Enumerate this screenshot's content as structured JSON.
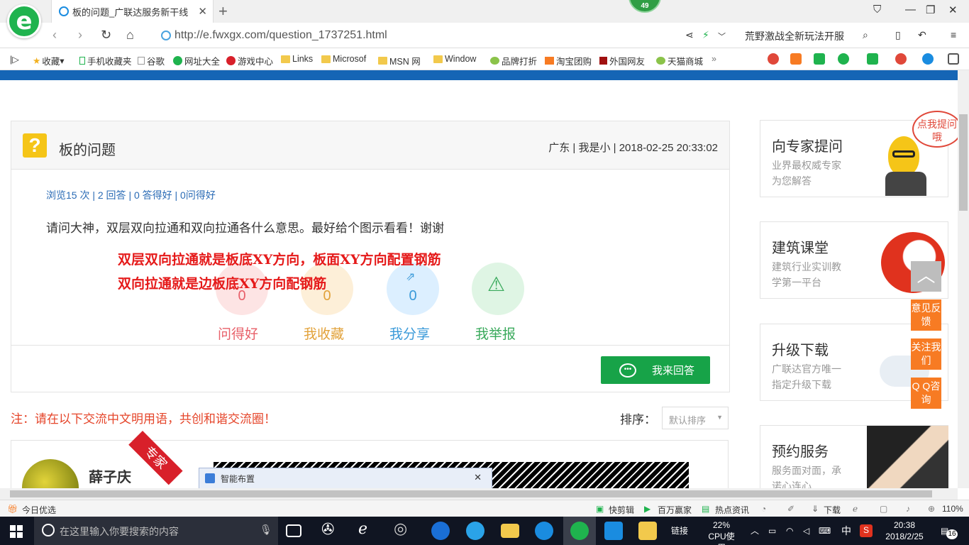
{
  "browser": {
    "tab_title": "板的问题_广联达服务新干线",
    "notif_count": "49",
    "url": "http://e.fwxgx.com/question_1737251.html",
    "news_ticker": "荒野激战全新玩法开服"
  },
  "bookmarks": [
    {
      "label": "收藏"
    },
    {
      "label": "手机收藏夹"
    },
    {
      "label": "谷歌"
    },
    {
      "label": "网址大全"
    },
    {
      "label": "游戏中心"
    },
    {
      "label": "Links"
    },
    {
      "label": "Microsof"
    },
    {
      "label": "MSN 网"
    },
    {
      "label": "Window"
    },
    {
      "label": "品牌打折"
    },
    {
      "label": "淘宝团购"
    },
    {
      "label": "外国网友"
    },
    {
      "label": "天猫商城"
    }
  ],
  "question": {
    "title": "板的问题",
    "meta": "广东 | 我是小 | 2018-02-25 20:33:02",
    "stats": "浏览15 次 | 2 回答 | 0 答得好 | 0问得好",
    "body": "请问大神，双层双向拉通和双向拉通各什么意思。最好给个图示看看！谢谢",
    "annotation_line1": "双层双向拉通就是板底XY方向，板面XY方向配置钢筋",
    "annotation_line2": "双向拉通就是边板底XY方向配钢筋",
    "actions": [
      {
        "label": "问得好",
        "count": "0",
        "color": "#e8606a"
      },
      {
        "label": "我收藏",
        "count": "0",
        "color": "#e2a23a"
      },
      {
        "label": "我分享",
        "count": "0",
        "color": "#3a9ad9"
      },
      {
        "label": "我举报",
        "count": "",
        "color": "#3aaa5c"
      }
    ],
    "answer_button": "我来回答"
  },
  "answers_section": {
    "notice": "注：请在以下交流中文明用语，共创和谐交流圈！",
    "sort_label": "排序：",
    "sort_value": "默认排序",
    "first_answer": {
      "name": "薛子庆",
      "ribbon": "专家",
      "dialog_title": "智能布置"
    }
  },
  "sidebar": [
    {
      "title": "向专家提问",
      "sub1": "业界最权威专家",
      "sub2": "为您解答",
      "bubble": "点我提问哦"
    },
    {
      "title": "建筑课堂",
      "sub1": "建筑行业实训教",
      "sub2": "学第一平台"
    },
    {
      "title": "升级下载",
      "sub1": "广联达官方唯一",
      "sub2": "指定升级下载"
    },
    {
      "title": "预约服务",
      "sub1": "服务面对面，承",
      "sub2": "诺心连心"
    }
  ],
  "float_buttons": [
    "意见反馈",
    "关注我们",
    "Q Q咨询"
  ],
  "statusbar": {
    "left": "今日优选",
    "items": [
      "快剪辑",
      "百万赢家",
      "热点资讯",
      "下载"
    ],
    "zoom": "110%"
  },
  "taskbar": {
    "search_placeholder": "在这里输入你要搜索的内容",
    "links_label": "链接",
    "cpu_percent": "22%",
    "cpu_label": "CPU使用",
    "ime": "中",
    "time": "20:38",
    "date": "2018/2/25",
    "notifications": "16"
  },
  "colors": {
    "brand_blue": "#1565b5",
    "answer_green": "#17a348",
    "annotation_red": "#e51a1a",
    "float_orange": "#f77b23"
  }
}
